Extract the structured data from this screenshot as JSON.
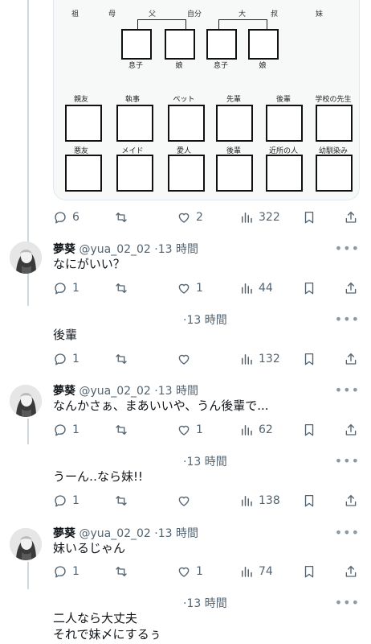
{
  "diagram": {
    "top_labels": [
      "祖",
      "母",
      "父",
      "自分",
      "大",
      "叔",
      "妹"
    ],
    "children_labels": [
      "息子",
      "娘",
      "息子",
      "娘"
    ],
    "row1_labels": [
      "親友",
      "執事",
      "ペット",
      "先輩",
      "後輩",
      "学校の先生"
    ],
    "row2_labels": [
      "悪友",
      "メイド",
      "愛人",
      "後輩",
      "近所の人",
      "幼馴染み"
    ]
  },
  "tweets": [
    {
      "stats": {
        "replies": "6",
        "retweets": "",
        "likes": "2",
        "views": "322"
      }
    },
    {
      "name": "夢葵",
      "handle": "@yua_02_02",
      "time": "13 時間",
      "text": "なにがいい？",
      "stats": {
        "replies": "1",
        "retweets": "",
        "likes": "1",
        "views": "44"
      }
    },
    {
      "name": "",
      "handle": "",
      "time": "13 時間",
      "text": "後輩",
      "stats": {
        "replies": "1",
        "retweets": "",
        "likes": "",
        "views": "132"
      }
    },
    {
      "name": "夢葵",
      "handle": "@yua_02_02",
      "time": "13 時間",
      "text": "なんかさぁ、まあいいや、うん後輩で...",
      "stats": {
        "replies": "1",
        "retweets": "",
        "likes": "1",
        "views": "62"
      }
    },
    {
      "name": "",
      "handle": "",
      "time": "13 時間",
      "text": "うーん‥なら妹!!",
      "stats": {
        "replies": "1",
        "retweets": "",
        "likes": "",
        "views": "138"
      }
    },
    {
      "name": "夢葵",
      "handle": "@yua_02_02",
      "time": "13 時間",
      "text": "妹いるじゃん",
      "stats": {
        "replies": "1",
        "retweets": "",
        "likes": "1",
        "views": "74"
      }
    },
    {
      "name": "",
      "handle": "",
      "time": "13 時間",
      "text": "二人なら大丈夫\nそれで妹〆にするぅ"
    }
  ],
  "separator": "·",
  "more_label": "•••"
}
